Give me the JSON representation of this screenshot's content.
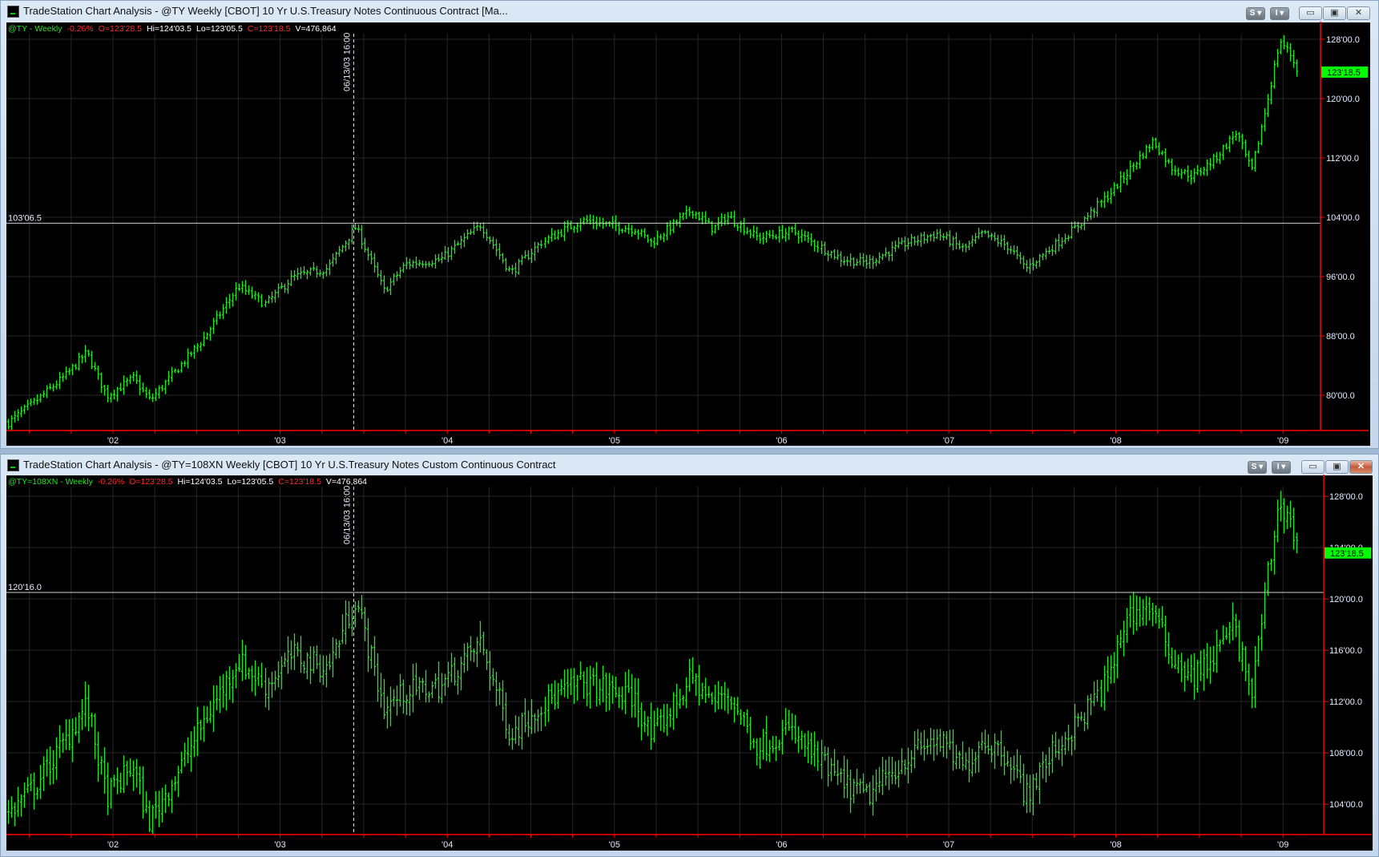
{
  "windows": [
    {
      "title": "TradeStation Chart Analysis - @TY  Weekly  [CBOT] 10 Yr U.S.Treasury Notes Continuous Contract [Ma...",
      "buttons": {
        "s": "S ▾",
        "i": "I ▾",
        "minimize": "▭",
        "maximize": "▣",
        "close": "✕"
      },
      "header": {
        "symbol": "@TY - Weekly",
        "change": "-0.26%",
        "open": "O=123'28.5",
        "high": "Hi=124'03.5",
        "low": "Lo=123'05.5",
        "close": "C=123'18.5",
        "volume": "V=476,864"
      }
    },
    {
      "title": "TradeStation Chart Analysis - @TY=108XN  Weekly  [CBOT] 10 Yr U.S.Treasury Notes Custom Continuous Contract",
      "buttons": {
        "s": "S ▾",
        "i": "I ▾",
        "minimize": "▭",
        "maximize": "▣",
        "close": "✕"
      },
      "header": {
        "symbol": "@TY=108XN - Weekly",
        "change": "-0.26%",
        "open": "O=123'28.5",
        "high": "Hi=124'03.5",
        "low": "Lo=123'05.5",
        "close": "C=123'18.5",
        "volume": "V=476,864"
      }
    }
  ],
  "colors": {
    "bar": "#1ee81e",
    "axis": "#ff0000",
    "grid": "#262626",
    "last_price_bg": "#00ff00",
    "hline": "#d0d0d0",
    "vline": "#cfe3ff"
  },
  "chart_data": [
    {
      "type": "ohlc",
      "title": "@TY - Weekly",
      "interval": "weekly",
      "ylim": [
        75,
        129
      ],
      "yticks": [
        {
          "value": 128,
          "label": "128'00.0"
        },
        {
          "value": 120,
          "label": "120'00.0"
        },
        {
          "value": 112,
          "label": "112'00.0"
        },
        {
          "value": 104,
          "label": "104'00.0"
        },
        {
          "value": 96,
          "label": "96'00.0"
        },
        {
          "value": 88,
          "label": "88'00.0"
        },
        {
          "value": 80,
          "label": "80'00.0"
        }
      ],
      "xticks": [
        {
          "year": 2002,
          "label": "'02"
        },
        {
          "year": 2003,
          "label": "'03"
        },
        {
          "year": 2004,
          "label": "'04"
        },
        {
          "year": 2005,
          "label": "'05"
        },
        {
          "year": 2006,
          "label": "'06"
        },
        {
          "year": 2007,
          "label": "'07"
        },
        {
          "year": 2008,
          "label": "'08"
        },
        {
          "year": 2009,
          "label": "'09"
        }
      ],
      "last_price": {
        "value": 123.578,
        "label": "123'18.5"
      },
      "horizontal_line": {
        "value": 103.203,
        "label": "103'06.5"
      },
      "vertical_line": {
        "year": 2003.45,
        "label": "06/13/03 16:00"
      },
      "close_path": [
        [
          2001.37,
          76.3
        ],
        [
          2001.54,
          79.3
        ],
        [
          2001.72,
          82.8
        ],
        [
          2001.84,
          85.8
        ],
        [
          2001.96,
          79.9
        ],
        [
          2002.12,
          82.3
        ],
        [
          2002.22,
          79.3
        ],
        [
          2002.38,
          83.4
        ],
        [
          2002.54,
          87.6
        ],
        [
          2002.75,
          94.7
        ],
        [
          2002.91,
          92.3
        ],
        [
          2003.07,
          95.9
        ],
        [
          2003.28,
          97.1
        ],
        [
          2003.45,
          102.7
        ],
        [
          2003.62,
          94.1
        ],
        [
          2003.75,
          97.7
        ],
        [
          2003.96,
          98.3
        ],
        [
          2004.2,
          103.0
        ],
        [
          2004.38,
          96.5
        ],
        [
          2004.56,
          100.6
        ],
        [
          2004.8,
          103.6
        ],
        [
          2005.12,
          102.4
        ],
        [
          2005.22,
          100.6
        ],
        [
          2005.46,
          105.0
        ],
        [
          2005.59,
          102.4
        ],
        [
          2005.67,
          104.2
        ],
        [
          2005.86,
          101.2
        ],
        [
          2006.07,
          102.1
        ],
        [
          2006.36,
          98.3
        ],
        [
          2006.51,
          97.9
        ],
        [
          2006.75,
          100.6
        ],
        [
          2006.93,
          101.8
        ],
        [
          2007.09,
          99.7
        ],
        [
          2007.2,
          101.8
        ],
        [
          2007.36,
          100.0
        ],
        [
          2007.46,
          97.1
        ],
        [
          2007.62,
          100.0
        ],
        [
          2007.78,
          103.0
        ],
        [
          2007.96,
          107.2
        ],
        [
          2008.22,
          114.3
        ],
        [
          2008.33,
          110.7
        ],
        [
          2008.46,
          109.5
        ],
        [
          2008.59,
          111.9
        ],
        [
          2008.72,
          115.5
        ],
        [
          2008.81,
          110.1
        ],
        [
          2008.91,
          120.2
        ],
        [
          2008.98,
          127.9
        ],
        [
          2009.04,
          126.1
        ],
        [
          2009.09,
          123.6
        ]
      ]
    },
    {
      "type": "ohlc",
      "title": "@TY=108XN - Weekly",
      "interval": "weekly",
      "ylim": [
        102,
        129.5
      ],
      "yticks": [
        {
          "value": 128,
          "label": "128'00.0"
        },
        {
          "value": 124,
          "label": "124'00.0"
        },
        {
          "value": 120,
          "label": "120'00.0"
        },
        {
          "value": 116,
          "label": "116'00.0"
        },
        {
          "value": 112,
          "label": "112'00.0"
        },
        {
          "value": 108,
          "label": "108'00.0"
        },
        {
          "value": 104,
          "label": "104'00.0"
        }
      ],
      "xticks": [
        {
          "year": 2002,
          "label": "'02"
        },
        {
          "year": 2003,
          "label": "'03"
        },
        {
          "year": 2004,
          "label": "'04"
        },
        {
          "year": 2005,
          "label": "'05"
        },
        {
          "year": 2006,
          "label": "'06"
        },
        {
          "year": 2007,
          "label": "'07"
        },
        {
          "year": 2008,
          "label": "'08"
        },
        {
          "year": 2009,
          "label": "'09"
        }
      ],
      "last_price": {
        "value": 123.578,
        "label": "123'18.5"
      },
      "horizontal_line": {
        "value": 120.5,
        "label": "120'16.0"
      },
      "vertical_line": {
        "year": 2003.45,
        "label": "06/13/03 16:00"
      },
      "close_path": [
        [
          2001.37,
          103.2
        ],
        [
          2001.54,
          105.6
        ],
        [
          2001.72,
          109.1
        ],
        [
          2001.84,
          111.8
        ],
        [
          2001.96,
          104.6
        ],
        [
          2002.12,
          107.0
        ],
        [
          2002.21,
          102.6
        ],
        [
          2002.38,
          106.3
        ],
        [
          2002.54,
          110.4
        ],
        [
          2002.75,
          115.2
        ],
        [
          2002.91,
          113.2
        ],
        [
          2003.07,
          115.6
        ],
        [
          2003.28,
          114.6
        ],
        [
          2003.45,
          120.0
        ],
        [
          2003.62,
          111.5
        ],
        [
          2003.75,
          112.8
        ],
        [
          2003.96,
          113.2
        ],
        [
          2004.2,
          116.6
        ],
        [
          2004.38,
          109.4
        ],
        [
          2004.56,
          111.8
        ],
        [
          2004.8,
          113.5
        ],
        [
          2005.12,
          112.2
        ],
        [
          2005.22,
          109.1
        ],
        [
          2005.46,
          113.9
        ],
        [
          2005.59,
          111.8
        ],
        [
          2005.67,
          112.8
        ],
        [
          2005.86,
          108.4
        ],
        [
          2006.04,
          109.8
        ],
        [
          2006.36,
          105.6
        ],
        [
          2006.51,
          104.6
        ],
        [
          2006.75,
          107.7
        ],
        [
          2006.93,
          109.1
        ],
        [
          2007.09,
          106.7
        ],
        [
          2007.2,
          109.1
        ],
        [
          2007.36,
          107.7
        ],
        [
          2007.46,
          104.6
        ],
        [
          2007.62,
          108.0
        ],
        [
          2007.78,
          110.4
        ],
        [
          2007.96,
          113.9
        ],
        [
          2008.06,
          118.7
        ],
        [
          2008.2,
          119.4
        ],
        [
          2008.33,
          115.6
        ],
        [
          2008.46,
          113.9
        ],
        [
          2008.59,
          115.6
        ],
        [
          2008.7,
          118.0
        ],
        [
          2008.81,
          112.5
        ],
        [
          2008.91,
          122.1
        ],
        [
          2008.98,
          127.6
        ],
        [
          2009.04,
          126.2
        ],
        [
          2009.09,
          123.6
        ]
      ]
    }
  ]
}
